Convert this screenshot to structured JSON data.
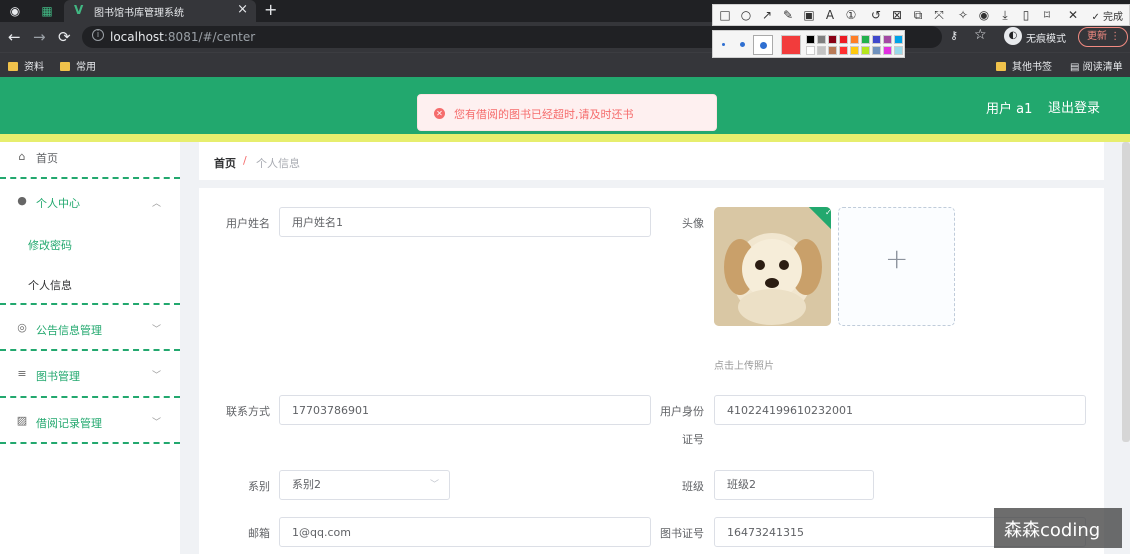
{
  "browser": {
    "tab_title": "图书馆书库管理系统",
    "url_host": "localhost",
    "url_path": ":8081/#/center",
    "incognito_label": "无痕模式",
    "update_label": "更新",
    "bookmarks": [
      {
        "label": "资料"
      },
      {
        "label": "常用"
      },
      {
        "label": "其他书签"
      },
      {
        "label": "阅读清单"
      }
    ]
  },
  "snip_toolbar": {
    "done_label": "完成",
    "current_color": "#f23c3c"
  },
  "header": {
    "background": "#22a86e",
    "user_label": "用户 a1",
    "logout_label": "退出登录"
  },
  "alert": {
    "type": "error",
    "message": "您有借阅的图书已经超时,请及时还书"
  },
  "sidebar": {
    "items": [
      {
        "label": "首页",
        "icon": "home-icon"
      },
      {
        "label": "个人中心",
        "icon": "user-icon",
        "expanded": true,
        "children": [
          {
            "label": "修改密码"
          },
          {
            "label": "个人信息"
          }
        ]
      },
      {
        "label": "公告信息管理",
        "icon": "bell-icon"
      },
      {
        "label": "图书管理",
        "icon": "list-icon"
      },
      {
        "label": "借阅记录管理",
        "icon": "clipboard-icon"
      }
    ]
  },
  "breadcrumb": {
    "home": "首页",
    "separator": "/",
    "current": "个人信息"
  },
  "form": {
    "username_label": "用户姓名",
    "username_value": "用户姓名1",
    "avatar_label": "头像",
    "upload_hint": "点击上传照片",
    "contact_label": "联系方式",
    "contact_value": "17703786901",
    "idcard_label_1": "用户身份",
    "idcard_label_2": "证号",
    "idcard_value": "410224199610232001",
    "department_label": "系别",
    "department_value": "系别2",
    "class_label": "班级",
    "class_value": "班级2",
    "email_label": "邮箱",
    "email_value": "1@qq.com",
    "libcard_label": "图书证号",
    "libcard_value": "16473241315"
  },
  "watermark": "森森coding"
}
